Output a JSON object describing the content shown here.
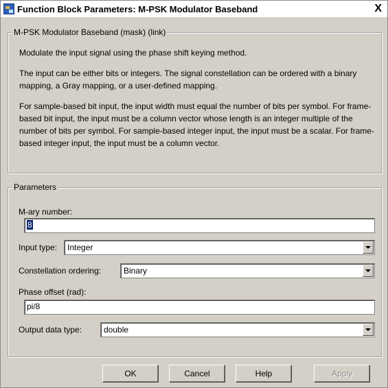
{
  "window": {
    "title": "Function Block Parameters: M-PSK Modulator Baseband",
    "close_glyph": "X"
  },
  "mask_group": {
    "legend": "M-PSK Modulator Baseband (mask) (link)",
    "paragraphs": [
      "Modulate the input signal using the phase shift keying method.",
      "The input can be either bits or integers. The signal constellation can be ordered with a binary mapping, a Gray mapping, or a user-defined mapping.",
      "For sample-based bit input, the input width must equal the number of bits per symbol. For frame-based bit input, the input must be a column vector whose length is an integer multiple of the number of bits per symbol. For sample-based integer input, the input must be a scalar. For frame-based integer input, the input must be a column vector."
    ]
  },
  "params_group": {
    "legend": "Parameters",
    "mary_label": "M-ary number:",
    "mary_value": "8",
    "input_type_label": "Input type:",
    "input_type_value": "Integer",
    "constellation_label": "Constellation ordering:",
    "constellation_value": "Binary",
    "phase_label": "Phase offset (rad):",
    "phase_value": "pi/8",
    "output_label": "Output data type:",
    "output_value": "double"
  },
  "buttons": {
    "ok": "OK",
    "cancel": "Cancel",
    "help": "Help",
    "apply": "Apply"
  },
  "icons": {
    "app": "simulink-block-icon",
    "close": "close-icon",
    "dropdown": "chevron-down-icon"
  }
}
